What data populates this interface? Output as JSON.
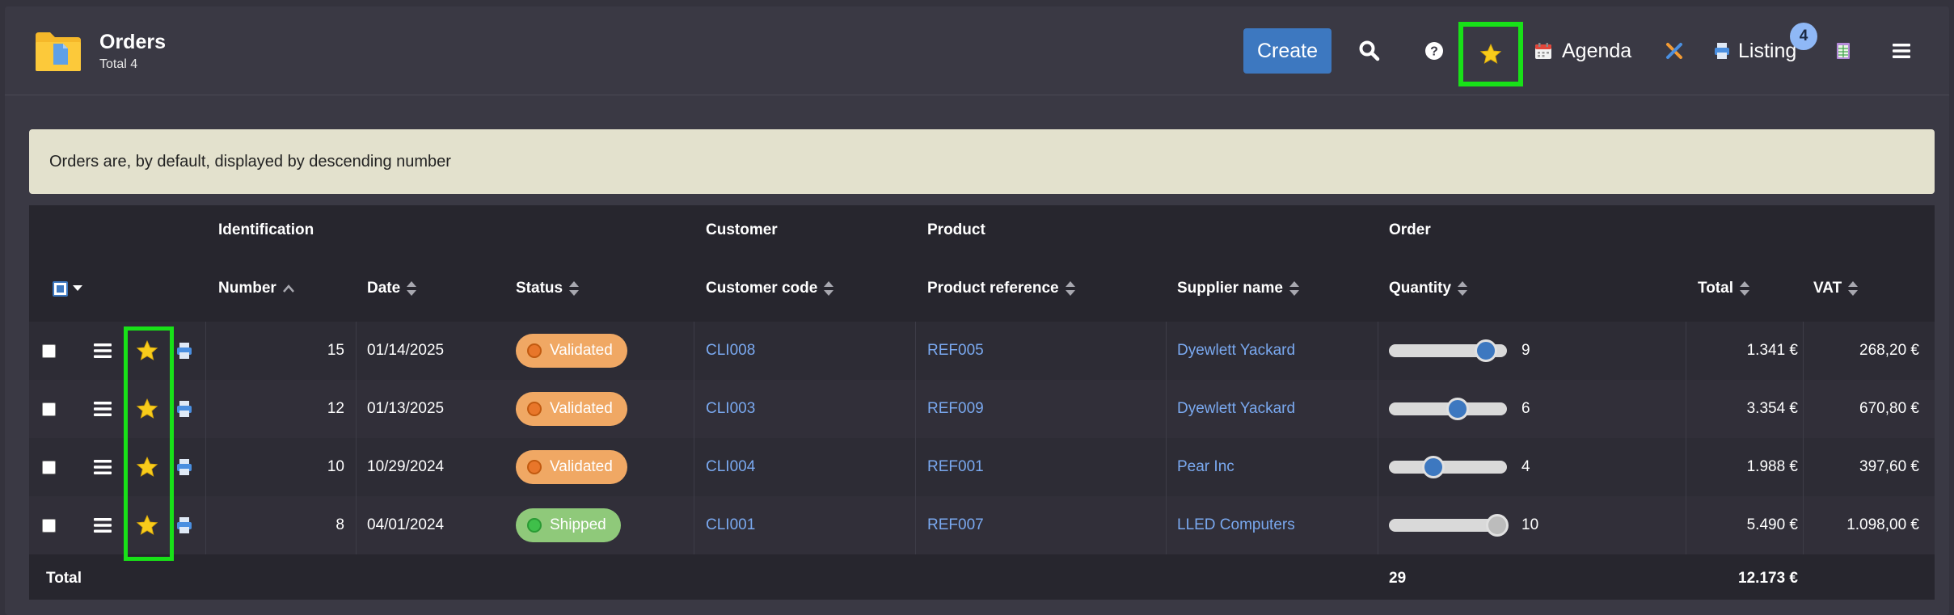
{
  "header": {
    "title": "Orders",
    "subtitle": "Total 4",
    "create_label": "Create",
    "agenda_label": "Agenda",
    "listing_label": "Listing",
    "listing_badge": "4"
  },
  "banner": {
    "text": "Orders are, by default, displayed by descending number"
  },
  "table": {
    "groups": {
      "identification": "Identification",
      "customer": "Customer",
      "product": "Product",
      "order": "Order"
    },
    "columns": {
      "number": "Number",
      "date": "Date",
      "status": "Status",
      "customer_code": "Customer code",
      "product_reference": "Product reference",
      "supplier_name": "Supplier name",
      "quantity": "Quantity",
      "total": "Total",
      "vat": "VAT"
    },
    "rows": [
      {
        "number": "15",
        "date": "01/14/2025",
        "status": "Validated",
        "status_kind": "validated",
        "customer_code": "CLI008",
        "product_reference": "REF005",
        "supplier_name": "Dyewlett Yackard",
        "quantity": "9",
        "quantity_fraction": 0.82,
        "total": "1.341 €",
        "vat": "268,20 €"
      },
      {
        "number": "12",
        "date": "01/13/2025",
        "status": "Validated",
        "status_kind": "validated",
        "customer_code": "CLI003",
        "product_reference": "REF009",
        "supplier_name": "Dyewlett Yackard",
        "quantity": "6",
        "quantity_fraction": 0.58,
        "total": "3.354 €",
        "vat": "670,80 €"
      },
      {
        "number": "10",
        "date": "10/29/2024",
        "status": "Validated",
        "status_kind": "validated",
        "customer_code": "CLI004",
        "product_reference": "REF001",
        "supplier_name": "Pear Inc",
        "quantity": "4",
        "quantity_fraction": 0.38,
        "total": "1.988 €",
        "vat": "397,60 €"
      },
      {
        "number": "8",
        "date": "04/01/2024",
        "status": "Shipped",
        "status_kind": "shipped",
        "customer_code": "CLI001",
        "product_reference": "REF007",
        "supplier_name": "LLED Computers",
        "quantity": "10",
        "quantity_fraction": 0.92,
        "total": "5.490 €",
        "vat": "1.098,00 €"
      }
    ],
    "footer": {
      "label": "Total",
      "quantity": "29",
      "total": "12.173 €"
    }
  },
  "colors": {
    "accent": "#3d78c0",
    "highlight": "#18e118",
    "link": "#7aa9f0",
    "validated": "#f0a864",
    "shipped": "#8fc97a"
  }
}
